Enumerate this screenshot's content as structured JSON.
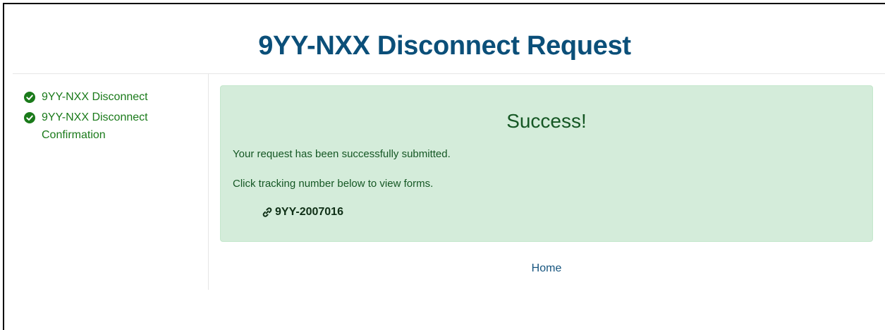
{
  "page": {
    "title": "9YY-NXX Disconnect Request"
  },
  "sidebar": {
    "steps": [
      {
        "label": "9YY-NXX Disconnect",
        "icon": "check-circle-icon",
        "status": "complete"
      },
      {
        "label": "9YY-NXX Disconnect Confirmation",
        "icon": "check-circle-icon",
        "status": "complete"
      }
    ]
  },
  "alert": {
    "heading": "Success!",
    "message": "Your request has been successfully submitted.",
    "instruction": "Click tracking number below to view forms.",
    "tracking_number": "9YY-2007016",
    "tracking_icon": "link-icon"
  },
  "footer": {
    "home_label": "Home"
  },
  "colors": {
    "title": "#0b4f79",
    "step_text": "#1a7a1a",
    "alert_bg": "#d4ecda",
    "alert_text": "#155724",
    "link": "#17557f"
  }
}
